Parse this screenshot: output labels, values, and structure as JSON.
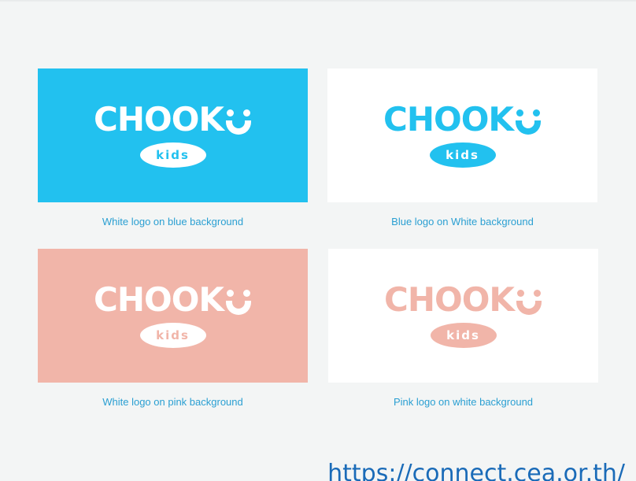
{
  "logo": {
    "wordmark": "CHOOK",
    "badge": "kids"
  },
  "variants": [
    {
      "caption": "White logo on blue background",
      "background": "#22c1ef",
      "logo_color": "#ffffff"
    },
    {
      "caption": "Blue logo on White background",
      "background": "#ffffff",
      "logo_color": "#22c1ef"
    },
    {
      "caption": "White logo on pink background",
      "background": "#f1b5a9",
      "logo_color": "#ffffff"
    },
    {
      "caption": "Pink logo on white background",
      "background": "#ffffff",
      "logo_color": "#f1b5a9"
    }
  ],
  "source_url": "https://connect.cea.or.th/",
  "colors": {
    "page_background": "#f3f5f5",
    "brand_blue": "#22c1ef",
    "brand_pink": "#f1b5a9",
    "caption_text": "#2a9fd2",
    "url_text": "#1a6bb8"
  }
}
